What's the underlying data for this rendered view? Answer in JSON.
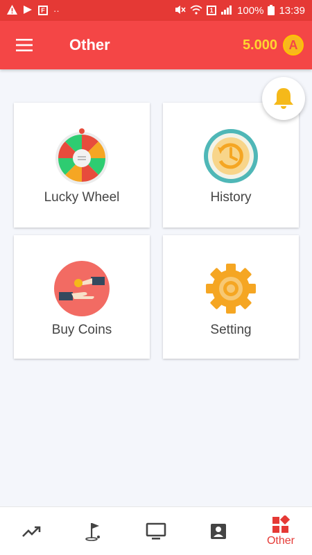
{
  "status_bar": {
    "battery": "100%",
    "time": "13:39",
    "sim_label": "1"
  },
  "app_bar": {
    "title": "Other",
    "coin_balance": "5.000",
    "coin_symbol": "A"
  },
  "grid": [
    {
      "label": "Lucky Wheel"
    },
    {
      "label": "History"
    },
    {
      "label": "Buy Coins"
    },
    {
      "label": "Setting"
    }
  ],
  "bottom_nav": {
    "items": [
      {
        "icon": "trending-up-icon"
      },
      {
        "icon": "golf-flag-icon"
      },
      {
        "icon": "tv-icon"
      },
      {
        "icon": "contact-icon"
      },
      {
        "icon": "widgets-icon",
        "label": "Other",
        "active": true
      }
    ]
  },
  "colors": {
    "primary": "#f44646",
    "status_bar": "#e53935",
    "coin": "#ffd630",
    "bell": "#f5b91a",
    "background": "#f4f6fb"
  }
}
